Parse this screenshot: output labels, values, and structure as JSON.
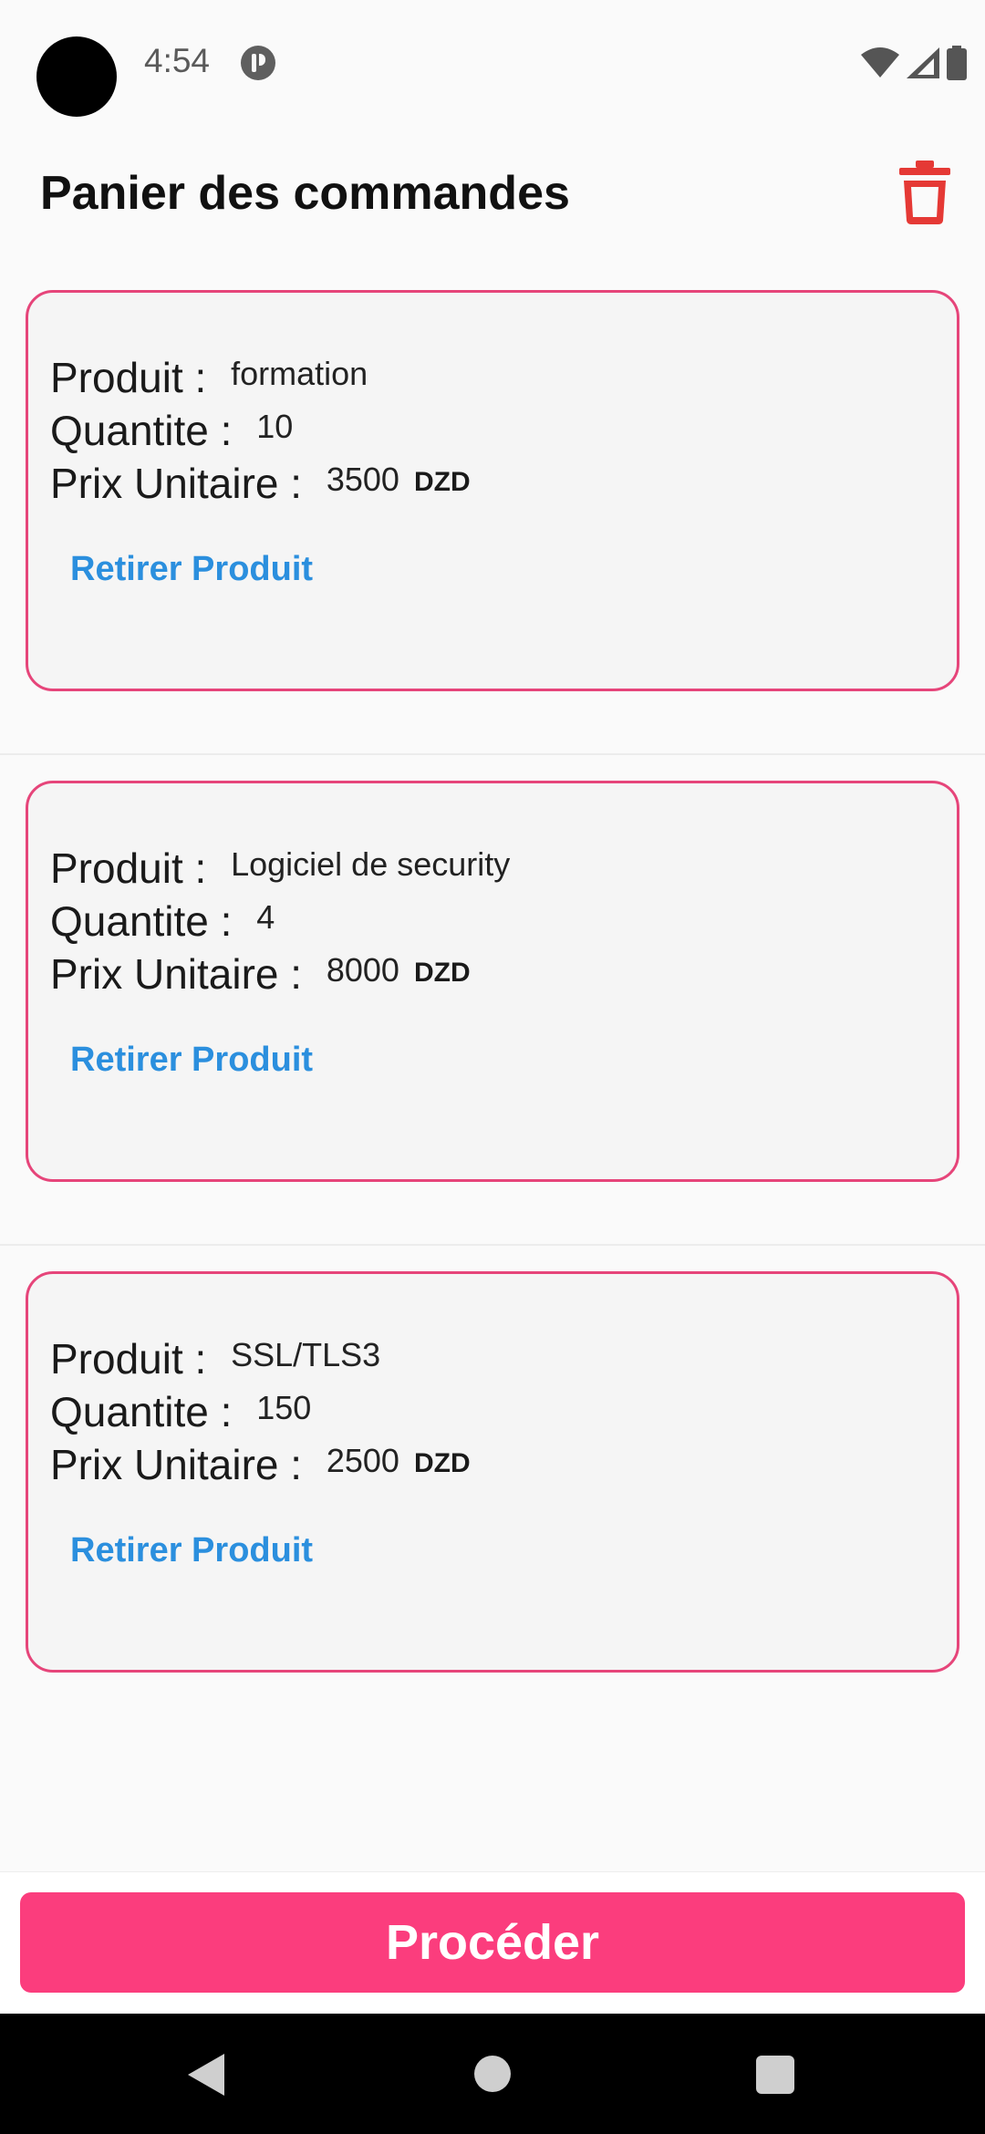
{
  "status_bar": {
    "time": "4:54",
    "icons": [
      "notification-icon",
      "wifi-icon",
      "signal-icon",
      "battery-icon"
    ]
  },
  "header": {
    "title": "Panier des commandes",
    "trash_icon": "trash-icon"
  },
  "labels": {
    "product": "Produit : ",
    "quantity": "Quantite : ",
    "unit_price": "Prix Unitaire : ",
    "remove": "Retirer Produit"
  },
  "items": [
    {
      "product": "formation",
      "quantity": "10",
      "price": "3500",
      "currency": "DZD"
    },
    {
      "product": "Logiciel de security",
      "quantity": "4",
      "price": "8000",
      "currency": "DZD"
    },
    {
      "product": "SSL/TLS3",
      "quantity": "150",
      "price": "2500",
      "currency": "DZD"
    }
  ],
  "footer": {
    "proceed_label": "Procéder"
  },
  "colors": {
    "accent": "#fb3d7d",
    "card_border": "#e6457a",
    "link": "#2b8fde",
    "trash": "#e53935"
  }
}
